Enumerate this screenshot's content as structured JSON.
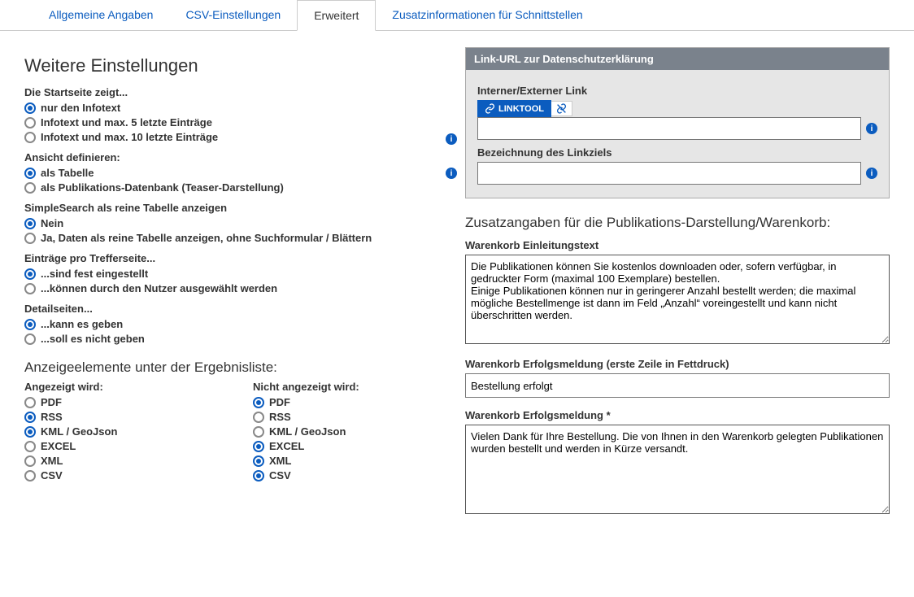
{
  "tabs": [
    {
      "label": "Allgemeine Angaben",
      "active": false
    },
    {
      "label": "CSV-Einstellungen",
      "active": false
    },
    {
      "label": "Erweitert",
      "active": true
    },
    {
      "label": "Zusatzinformationen für Schnittstellen",
      "active": false
    }
  ],
  "left": {
    "heading": "Weitere Einstellungen",
    "group_startpage": {
      "label": "Die Startseite zeigt...",
      "options": [
        {
          "label": "nur den Infotext",
          "checked": true
        },
        {
          "label": "Infotext und max. 5 letzte Einträge",
          "checked": false
        },
        {
          "label": "Infotext und max. 10 letzte Einträge",
          "checked": false
        }
      ]
    },
    "group_view": {
      "label": "Ansicht definieren:",
      "options": [
        {
          "label": "als Tabelle",
          "checked": true
        },
        {
          "label": "als Publikations-Datenbank (Teaser-Darstellung)",
          "checked": false
        }
      ]
    },
    "group_simplesearch": {
      "label": "SimpleSearch als reine Tabelle anzeigen",
      "options": [
        {
          "label": "Nein",
          "checked": true
        },
        {
          "label": "Ja, Daten als reine Tabelle anzeigen, ohne Suchformular / Blättern",
          "checked": false
        }
      ]
    },
    "group_perpage": {
      "label": "Einträge pro Trefferseite...",
      "options": [
        {
          "label": "...sind fest eingestellt",
          "checked": true
        },
        {
          "label": "...können durch den Nutzer ausgewählt werden",
          "checked": false
        }
      ]
    },
    "group_detail": {
      "label": "Detailseiten...",
      "options": [
        {
          "label": "...kann es geben",
          "checked": true
        },
        {
          "label": "...soll es nicht geben",
          "checked": false
        }
      ]
    },
    "elements_heading": "Anzeigeelemente unter der Ergebnisliste:",
    "shown": {
      "label": "Angezeigt wird:",
      "options": [
        {
          "label": "PDF",
          "checked": false
        },
        {
          "label": "RSS",
          "checked": true
        },
        {
          "label": "KML / GeoJson",
          "checked": true
        },
        {
          "label": "EXCEL",
          "checked": false
        },
        {
          "label": "XML",
          "checked": false
        },
        {
          "label": "CSV",
          "checked": false
        }
      ]
    },
    "notshown": {
      "label": "Nicht angezeigt wird:",
      "options": [
        {
          "label": "PDF",
          "checked": true
        },
        {
          "label": "RSS",
          "checked": false
        },
        {
          "label": "KML / GeoJson",
          "checked": false
        },
        {
          "label": "EXCEL",
          "checked": true
        },
        {
          "label": "XML",
          "checked": true
        },
        {
          "label": "CSV",
          "checked": true
        }
      ]
    }
  },
  "right": {
    "panel_title": "Link-URL zur Datenschutzerklärung",
    "link_label": "Interner/Externer Link",
    "linktool_label": "LINKTOOL",
    "link_value": "",
    "linktext_label": "Bezeichnung des Linkziels",
    "linktext_value": "",
    "section_title": "Zusatzangaben für die Publikations-Darstellung/Warenkorb:",
    "cart_intro_label": "Warenkorb Einleitungstext",
    "cart_intro_value": "Die Publikationen können Sie kostenlos downloaden oder, sofern verfügbar, in gedruckter Form (maximal 100 Exemplare) bestellen.                                                                          Einige Publikationen können nur in geringerer Anzahl bestellt werden; die maximal mögliche Bestellmenge ist dann im Feld „Anzahl“ voreingestellt und kann nicht überschritten werden.",
    "cart_success1_label": "Warenkorb Erfolgsmeldung (erste Zeile in Fettdruck)",
    "cart_success1_value": "Bestellung erfolgt",
    "cart_success2_label": "Warenkorb Erfolgsmeldung *",
    "cart_success2_value": "Vielen Dank für Ihre Bestellung. Die von Ihnen in den Warenkorb gelegten Publikationen wurden bestellt und werden in Kürze versandt."
  }
}
